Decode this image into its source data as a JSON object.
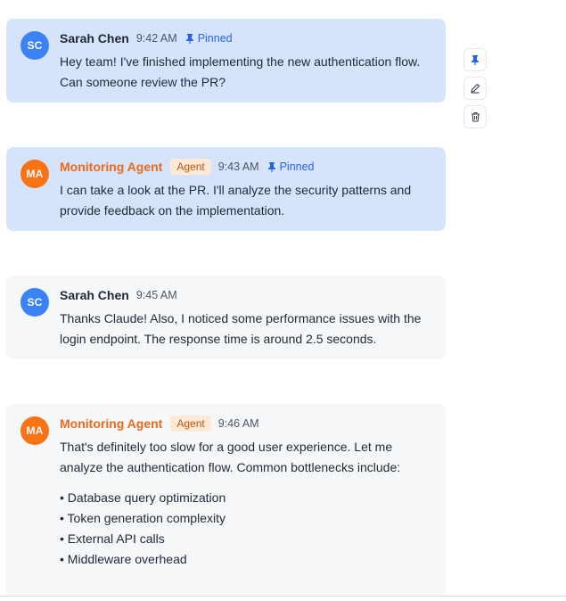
{
  "messages": [
    {
      "initials": "SC",
      "author": "Sarah Chen",
      "time": "9:42 AM",
      "pinned_label": "Pinned",
      "text": "Hey team! I've finished implementing the new authentication flow. Can someone review the PR?"
    },
    {
      "initials": "MA",
      "author": "Monitoring Agent",
      "badge": "Agent",
      "time": "9:43 AM",
      "pinned_label": "Pinned",
      "text": "I can take a look at the PR. I'll analyze the security patterns and provide feedback on the implementation."
    },
    {
      "initials": "SC",
      "author": "Sarah Chen",
      "time": "9:45 AM",
      "text": "Thanks Claude! Also, I noticed some performance issues with the login endpoint. The response time is around 2.5 seconds."
    },
    {
      "initials": "MA",
      "author": "Monitoring Agent",
      "badge": "Agent",
      "time": "9:46 AM",
      "text": "That's definitely too slow for a good user experience. Let me analyze the authentication flow. Common bottlenecks include:",
      "items": [
        "Database query optimization",
        "Token generation complexity",
        "External API calls",
        "Middleware overhead"
      ]
    }
  ],
  "toolbar": {
    "icons": [
      "pin-icon",
      "edit-icon",
      "trash-icon"
    ]
  },
  "colors": {
    "pinned_bg": "#d6e4fb",
    "plain_bg": "#f6f7f9",
    "user_avatar": "#3b82f6",
    "agent_avatar": "#f97316",
    "agent_name": "#ea6a1a",
    "pin_accent": "#2563eb"
  }
}
